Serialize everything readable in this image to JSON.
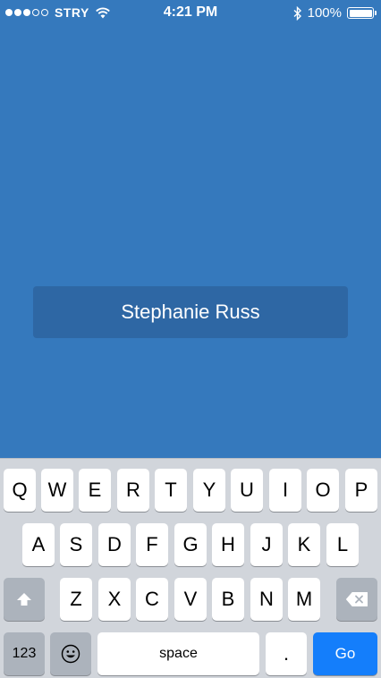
{
  "status_bar": {
    "carrier": "STRY",
    "time": "4:21 PM",
    "battery_percent": "100%",
    "signal_bars_filled": 3,
    "signal_bars_total": 5
  },
  "name_field": {
    "value": "Stephanie Russ"
  },
  "keyboard": {
    "row1": [
      "Q",
      "W",
      "E",
      "R",
      "T",
      "Y",
      "U",
      "I",
      "O",
      "P"
    ],
    "row2": [
      "A",
      "S",
      "D",
      "F",
      "G",
      "H",
      "J",
      "K",
      "L"
    ],
    "row3": [
      "Z",
      "X",
      "C",
      "V",
      "B",
      "N",
      "M"
    ],
    "numbers_key": "123",
    "space_key": "space",
    "period_key": ".",
    "go_key": "Go"
  },
  "colors": {
    "background": "#3579bd",
    "field": "#2e67a4",
    "go_key": "#147efb"
  }
}
